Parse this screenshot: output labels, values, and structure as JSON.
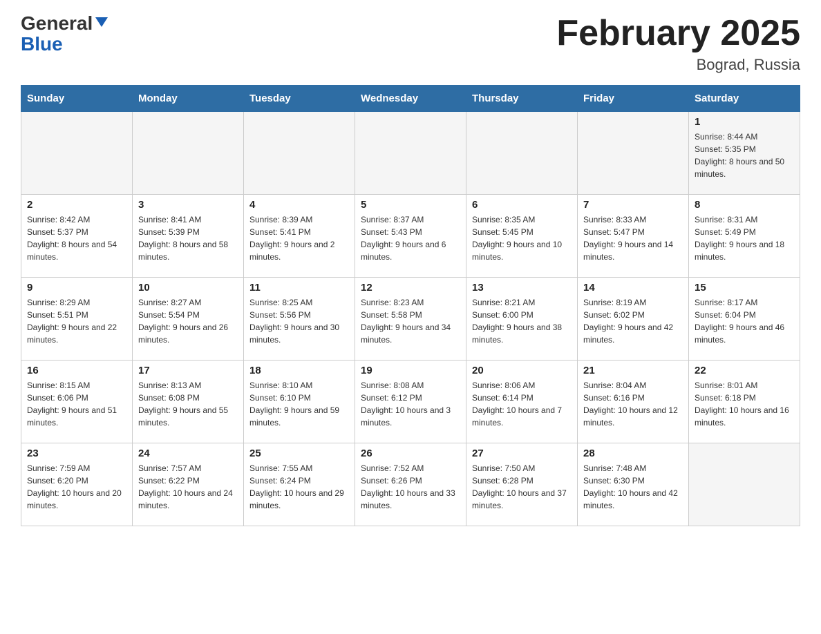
{
  "header": {
    "logo_line1": "General",
    "logo_line2": "Blue",
    "month_title": "February 2025",
    "location": "Bograd, Russia"
  },
  "weekdays": [
    "Sunday",
    "Monday",
    "Tuesday",
    "Wednesday",
    "Thursday",
    "Friday",
    "Saturday"
  ],
  "weeks": [
    [
      {
        "day": "",
        "sunrise": "",
        "sunset": "",
        "daylight": ""
      },
      {
        "day": "",
        "sunrise": "",
        "sunset": "",
        "daylight": ""
      },
      {
        "day": "",
        "sunrise": "",
        "sunset": "",
        "daylight": ""
      },
      {
        "day": "",
        "sunrise": "",
        "sunset": "",
        "daylight": ""
      },
      {
        "day": "",
        "sunrise": "",
        "sunset": "",
        "daylight": ""
      },
      {
        "day": "",
        "sunrise": "",
        "sunset": "",
        "daylight": ""
      },
      {
        "day": "1",
        "sunrise": "Sunrise: 8:44 AM",
        "sunset": "Sunset: 5:35 PM",
        "daylight": "Daylight: 8 hours and 50 minutes."
      }
    ],
    [
      {
        "day": "2",
        "sunrise": "Sunrise: 8:42 AM",
        "sunset": "Sunset: 5:37 PM",
        "daylight": "Daylight: 8 hours and 54 minutes."
      },
      {
        "day": "3",
        "sunrise": "Sunrise: 8:41 AM",
        "sunset": "Sunset: 5:39 PM",
        "daylight": "Daylight: 8 hours and 58 minutes."
      },
      {
        "day": "4",
        "sunrise": "Sunrise: 8:39 AM",
        "sunset": "Sunset: 5:41 PM",
        "daylight": "Daylight: 9 hours and 2 minutes."
      },
      {
        "day": "5",
        "sunrise": "Sunrise: 8:37 AM",
        "sunset": "Sunset: 5:43 PM",
        "daylight": "Daylight: 9 hours and 6 minutes."
      },
      {
        "day": "6",
        "sunrise": "Sunrise: 8:35 AM",
        "sunset": "Sunset: 5:45 PM",
        "daylight": "Daylight: 9 hours and 10 minutes."
      },
      {
        "day": "7",
        "sunrise": "Sunrise: 8:33 AM",
        "sunset": "Sunset: 5:47 PM",
        "daylight": "Daylight: 9 hours and 14 minutes."
      },
      {
        "day": "8",
        "sunrise": "Sunrise: 8:31 AM",
        "sunset": "Sunset: 5:49 PM",
        "daylight": "Daylight: 9 hours and 18 minutes."
      }
    ],
    [
      {
        "day": "9",
        "sunrise": "Sunrise: 8:29 AM",
        "sunset": "Sunset: 5:51 PM",
        "daylight": "Daylight: 9 hours and 22 minutes."
      },
      {
        "day": "10",
        "sunrise": "Sunrise: 8:27 AM",
        "sunset": "Sunset: 5:54 PM",
        "daylight": "Daylight: 9 hours and 26 minutes."
      },
      {
        "day": "11",
        "sunrise": "Sunrise: 8:25 AM",
        "sunset": "Sunset: 5:56 PM",
        "daylight": "Daylight: 9 hours and 30 minutes."
      },
      {
        "day": "12",
        "sunrise": "Sunrise: 8:23 AM",
        "sunset": "Sunset: 5:58 PM",
        "daylight": "Daylight: 9 hours and 34 minutes."
      },
      {
        "day": "13",
        "sunrise": "Sunrise: 8:21 AM",
        "sunset": "Sunset: 6:00 PM",
        "daylight": "Daylight: 9 hours and 38 minutes."
      },
      {
        "day": "14",
        "sunrise": "Sunrise: 8:19 AM",
        "sunset": "Sunset: 6:02 PM",
        "daylight": "Daylight: 9 hours and 42 minutes."
      },
      {
        "day": "15",
        "sunrise": "Sunrise: 8:17 AM",
        "sunset": "Sunset: 6:04 PM",
        "daylight": "Daylight: 9 hours and 46 minutes."
      }
    ],
    [
      {
        "day": "16",
        "sunrise": "Sunrise: 8:15 AM",
        "sunset": "Sunset: 6:06 PM",
        "daylight": "Daylight: 9 hours and 51 minutes."
      },
      {
        "day": "17",
        "sunrise": "Sunrise: 8:13 AM",
        "sunset": "Sunset: 6:08 PM",
        "daylight": "Daylight: 9 hours and 55 minutes."
      },
      {
        "day": "18",
        "sunrise": "Sunrise: 8:10 AM",
        "sunset": "Sunset: 6:10 PM",
        "daylight": "Daylight: 9 hours and 59 minutes."
      },
      {
        "day": "19",
        "sunrise": "Sunrise: 8:08 AM",
        "sunset": "Sunset: 6:12 PM",
        "daylight": "Daylight: 10 hours and 3 minutes."
      },
      {
        "day": "20",
        "sunrise": "Sunrise: 8:06 AM",
        "sunset": "Sunset: 6:14 PM",
        "daylight": "Daylight: 10 hours and 7 minutes."
      },
      {
        "day": "21",
        "sunrise": "Sunrise: 8:04 AM",
        "sunset": "Sunset: 6:16 PM",
        "daylight": "Daylight: 10 hours and 12 minutes."
      },
      {
        "day": "22",
        "sunrise": "Sunrise: 8:01 AM",
        "sunset": "Sunset: 6:18 PM",
        "daylight": "Daylight: 10 hours and 16 minutes."
      }
    ],
    [
      {
        "day": "23",
        "sunrise": "Sunrise: 7:59 AM",
        "sunset": "Sunset: 6:20 PM",
        "daylight": "Daylight: 10 hours and 20 minutes."
      },
      {
        "day": "24",
        "sunrise": "Sunrise: 7:57 AM",
        "sunset": "Sunset: 6:22 PM",
        "daylight": "Daylight: 10 hours and 24 minutes."
      },
      {
        "day": "25",
        "sunrise": "Sunrise: 7:55 AM",
        "sunset": "Sunset: 6:24 PM",
        "daylight": "Daylight: 10 hours and 29 minutes."
      },
      {
        "day": "26",
        "sunrise": "Sunrise: 7:52 AM",
        "sunset": "Sunset: 6:26 PM",
        "daylight": "Daylight: 10 hours and 33 minutes."
      },
      {
        "day": "27",
        "sunrise": "Sunrise: 7:50 AM",
        "sunset": "Sunset: 6:28 PM",
        "daylight": "Daylight: 10 hours and 37 minutes."
      },
      {
        "day": "28",
        "sunrise": "Sunrise: 7:48 AM",
        "sunset": "Sunset: 6:30 PM",
        "daylight": "Daylight: 10 hours and 42 minutes."
      },
      {
        "day": "",
        "sunrise": "",
        "sunset": "",
        "daylight": ""
      }
    ]
  ]
}
